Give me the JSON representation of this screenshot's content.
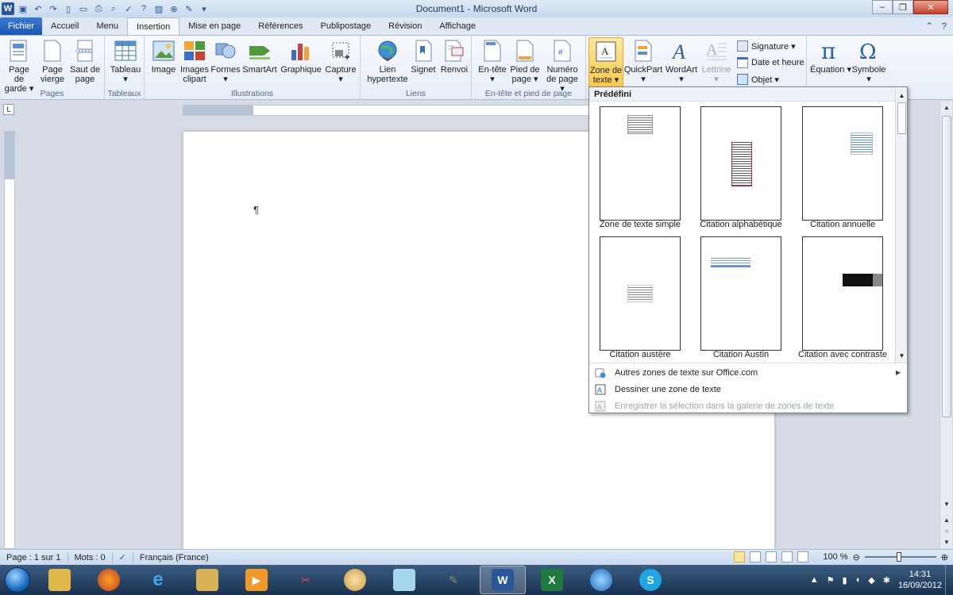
{
  "window": {
    "title": "Document1 - Microsoft Word",
    "min": "–",
    "max": "❐",
    "close": "✕"
  },
  "tabs": [
    {
      "label": "Fichier"
    },
    {
      "label": "Accueil"
    },
    {
      "label": "Menu"
    },
    {
      "label": "Insertion"
    },
    {
      "label": "Mise en page"
    },
    {
      "label": "Références"
    },
    {
      "label": "Publipostage"
    },
    {
      "label": "Révision"
    },
    {
      "label": "Affichage"
    }
  ],
  "ribbon": {
    "groups": {
      "pages": "Pages",
      "tableaux": "Tableaux",
      "illustrations": "Illustrations",
      "liens": "Liens",
      "entete": "En-tête et pied de page"
    },
    "buttons": {
      "page_de_garde": "Page de garde ▾",
      "page_vierge": "Page vierge",
      "saut_de_page": "Saut de page",
      "tableau": "Tableau ▾",
      "image": "Image",
      "images_clipart": "Images clipart",
      "formes": "Formes ▾",
      "smartart": "SmartArt",
      "graphique": "Graphique",
      "capture": "Capture ▾",
      "lien_hypertexte": "Lien hypertexte",
      "signet": "Signet",
      "renvoi": "Renvoi",
      "en_tete": "En-tête ▾",
      "pied_de_page": "Pied de page ▾",
      "numero_de_page": "Numéro de page ▾",
      "zone_de_texte": "Zone de texte ▾",
      "quickpart": "QuickPart ▾",
      "wordart": "WordArt ▾",
      "lettrine": "Lettrine ▾",
      "signature": "Signature ▾",
      "date_et_heure": "Date et heure",
      "objet": "Objet ▾",
      "equation": "Équation ▾",
      "symbole": "Symbole ▾"
    }
  },
  "document": {
    "pilcrow": "¶"
  },
  "dropdown": {
    "header": "Prédéfini",
    "thumbnails": [
      {
        "caption": "Zone de texte simple"
      },
      {
        "caption": "Citation alphabétique"
      },
      {
        "caption": "Citation annuelle"
      },
      {
        "caption": "Citation austère"
      },
      {
        "caption": "Citation Austin"
      },
      {
        "caption": "Citation avec contraste"
      }
    ],
    "menu": [
      {
        "label": "Autres zones de texte sur Office.com"
      },
      {
        "label": "Dessiner une zone de texte"
      },
      {
        "label": "Enregistrer la sélection dans la galerie de zones de texte"
      }
    ]
  },
  "status": {
    "page": "Page : 1 sur 1",
    "words": "Mots : 0",
    "language": "Français (France)",
    "zoom": "100 %"
  },
  "taskbar": {
    "clock_time": "14:31",
    "clock_date": "16/09/2012"
  },
  "colors": {
    "word_blue": "#2b579a",
    "accent_selected": "#f9c94a"
  }
}
